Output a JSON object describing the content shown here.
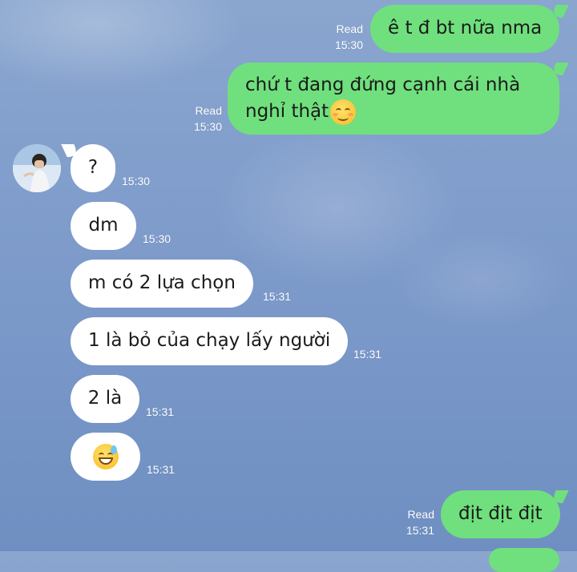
{
  "messages": [
    {
      "side": "out",
      "text": "ê t đ bt nữa nma",
      "read": "Read",
      "time": "15:30"
    },
    {
      "side": "out",
      "line1": "chứ t đang đứng cạnh cái nhà",
      "line2": "nghỉ thật",
      "emoji": "smiling-face-icon",
      "read": "Read",
      "time": "15:30"
    },
    {
      "side": "in",
      "text": "?",
      "time": "15:30"
    },
    {
      "side": "in",
      "text": "dm",
      "time": "15:30"
    },
    {
      "side": "in",
      "text": "m có 2 lựa chọn",
      "time": "15:31"
    },
    {
      "side": "in",
      "text": "1 là bỏ của chạy lấy người",
      "time": "15:31"
    },
    {
      "side": "in",
      "text": "2 là",
      "time": "15:31"
    },
    {
      "side": "in",
      "emoji": "grinning-sweat-icon",
      "time": "15:31"
    },
    {
      "side": "out",
      "text": "địt địt địt",
      "read": "Read",
      "time": "15:31"
    }
  ],
  "colors": {
    "outgoing": "#6fe07d",
    "incoming": "#ffffff",
    "background": "#7f9ccb"
  }
}
